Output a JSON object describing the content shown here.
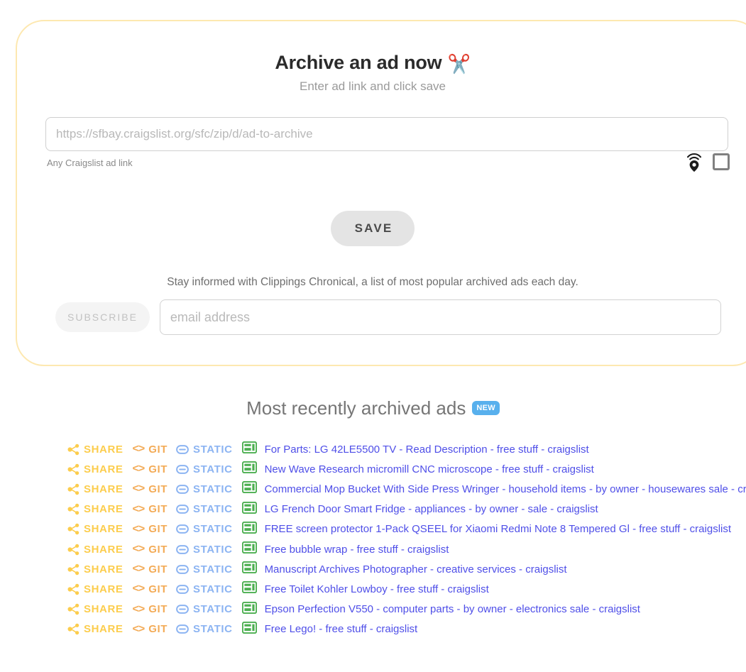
{
  "archive_card": {
    "title": "Archive an ad now",
    "title_icon": "scissors-emoji",
    "subtitle": "Enter ad link and click save",
    "url_placeholder": "https://sfbay.craigslist.org/sfc/zip/d/ad-to-archive",
    "url_value": "",
    "helper_text": "Any Craigslist ad link",
    "geo_icon": "location-pin-signal-icon",
    "checkbox_label": "",
    "checkbox_checked": false,
    "save_label": "SAVE",
    "subscribe_note": "Stay informed with Clippings Chronical, a list of most popular archived ads each day.",
    "subscribe_label": "SUBSCRIBE",
    "email_placeholder": "email address",
    "email_value": ""
  },
  "recent": {
    "heading": "Most recently archived ads",
    "badge": "NEW",
    "actions": {
      "share": "SHARE",
      "git": "GIT",
      "static": "STATIC",
      "git_glyph": "<>"
    },
    "items": [
      {
        "title": "For Parts: LG 42LE5500 TV - Read Description - free stuff - craigslist"
      },
      {
        "title": "New Wave Research micromill CNC microscope - free stuff - craigslist"
      },
      {
        "title": "Commercial Mop Bucket With Side Press Wringer - household items - by owner - housewares sale - craigslist"
      },
      {
        "title": "LG French Door Smart Fridge - appliances - by owner - sale - craigslist"
      },
      {
        "title": "FREE screen protector 1-Pack QSEEL for Xiaomi Redmi Note 8 Tempered Gl - free stuff - craigslist"
      },
      {
        "title": "Free bubble wrap - free stuff - craigslist"
      },
      {
        "title": "Manuscript Archives Photographer - creative services - craigslist"
      },
      {
        "title": "Free Toilet Kohler Lowboy - free stuff - craigslist"
      },
      {
        "title": "Epson Perfection V550 - computer parts - by owner - electronics sale - craigslist"
      },
      {
        "title": "Free Lego! - free stuff - craigslist"
      }
    ]
  },
  "colors": {
    "card_border": "#fde8b0",
    "share": "#fccd4d",
    "git": "#f3ab57",
    "static": "#8cb4f2",
    "screenshot_icon": "#4caf50",
    "link": "#4f4fe8",
    "badge": "#58b0ed"
  }
}
